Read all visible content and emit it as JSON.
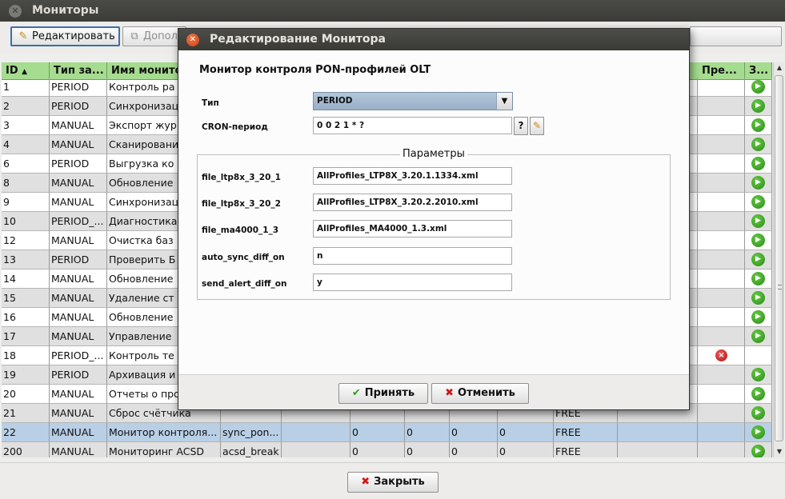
{
  "window": {
    "title": "Мониторы"
  },
  "toolbar": {
    "edit_label": "Редактировать",
    "add_label": "Допол"
  },
  "table": {
    "columns": [
      "ID",
      "Тип за...",
      "Имя монито",
      "Пре...",
      "З..."
    ],
    "rows": [
      {
        "id": "1",
        "type": "PERIOD",
        "name": "Контроль ра",
        "status": "",
        "action": "play"
      },
      {
        "id": "2",
        "type": "PERIOD",
        "name": "Синхронизац",
        "status": "",
        "action": "play"
      },
      {
        "id": "3",
        "type": "MANUAL",
        "name": "Экспорт жур",
        "status": "",
        "action": "play"
      },
      {
        "id": "4",
        "type": "MANUAL",
        "name": "Сканировани",
        "status": "",
        "action": "play"
      },
      {
        "id": "6",
        "type": "PERIOD",
        "name": "Выгрузка ко",
        "status": "",
        "action": "play"
      },
      {
        "id": "8",
        "type": "MANUAL",
        "name": "Обновление",
        "status": "",
        "action": "play"
      },
      {
        "id": "9",
        "type": "MANUAL",
        "name": "Синхронизац",
        "status": "",
        "action": "play"
      },
      {
        "id": "10",
        "type": "PERIOD_...",
        "name": "Диагностика",
        "status": "",
        "action": "play"
      },
      {
        "id": "12",
        "type": "MANUAL",
        "name": "Очистка баз",
        "status": "",
        "action": "play"
      },
      {
        "id": "13",
        "type": "PERIOD",
        "name": "Проверить Б",
        "status": "",
        "action": "play"
      },
      {
        "id": "14",
        "type": "MANUAL",
        "name": "Обновление",
        "status": "",
        "action": "play"
      },
      {
        "id": "15",
        "type": "MANUAL",
        "name": "Удаление ст",
        "status": "",
        "action": "play"
      },
      {
        "id": "16",
        "type": "MANUAL",
        "name": "Обновление",
        "status": "",
        "action": "play"
      },
      {
        "id": "17",
        "type": "MANUAL",
        "name": "Управление",
        "status": "",
        "action": "play"
      },
      {
        "id": "18",
        "type": "PERIOD_...",
        "name": "Контроль те",
        "status": "",
        "action": "stop"
      },
      {
        "id": "19",
        "type": "PERIOD",
        "name": "Архивация и",
        "status": "",
        "action": "play"
      },
      {
        "id": "20",
        "type": "MANUAL",
        "name": "Отчеты о про",
        "status": "",
        "action": "play"
      },
      {
        "id": "21",
        "type": "MANUAL",
        "name": "Сброс счётчика",
        "col4": "",
        "c5": "",
        "c6": "",
        "c7": "",
        "c8": "",
        "status": "FREE",
        "action": "play"
      },
      {
        "id": "22",
        "type": "MANUAL",
        "name": "Монитор контроля...",
        "col4": "sync_pon...",
        "c5": "0",
        "c6": "0",
        "c7": "0",
        "c8": "0",
        "status": "FREE",
        "action": "play"
      },
      {
        "id": "200",
        "type": "MANUAL",
        "name": "Мониторинг ACSD",
        "col4": "acsd_break",
        "c5": "0",
        "c6": "0",
        "c7": "0",
        "c8": "0",
        "status": "FREE",
        "action": "play"
      }
    ]
  },
  "footer": {
    "close_label": "Закрыть"
  },
  "dialog": {
    "title": "Редактирование Монитора",
    "heading": "Монитор контроля PON-профилей OLT",
    "type_label": "Тип",
    "type_value": "PERIOD",
    "cron_label": "CRON-период",
    "cron_value": "0 0 2 1 * ?",
    "help_label": "?",
    "params_legend": "Параметры",
    "params": [
      {
        "label": "file_ltp8x_3_20_1",
        "value": "AllProfiles_LTP8X_3.20.1.1334.xml"
      },
      {
        "label": "file_ltp8x_3_20_2",
        "value": "AllProfiles_LTP8X_3.20.2.2010.xml"
      },
      {
        "label": "file_ma4000_1_3",
        "value": "AllProfiles_MA4000_1.3.xml"
      },
      {
        "label": "auto_sync_diff_on",
        "value": "n"
      },
      {
        "label": "send_alert_diff_on",
        "value": "y"
      }
    ],
    "accept_label": "Принять",
    "cancel_label": "Отменить"
  }
}
